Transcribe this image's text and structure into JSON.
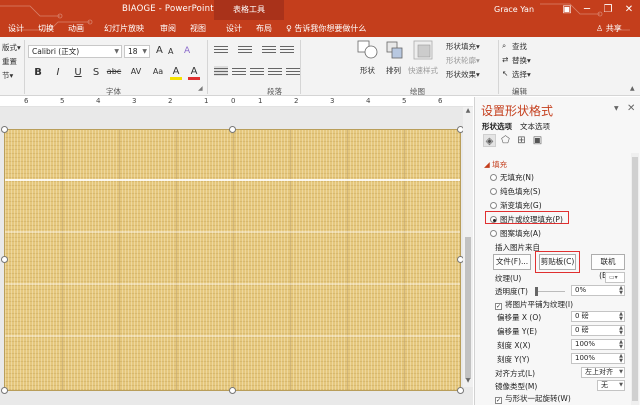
{
  "titlebar": {
    "doc_title": "BIAOGE  -  PowerPoint",
    "context_tab": "表格工具",
    "user": "Grace Yan",
    "controls": {
      "ribbon_display": "▣",
      "minimize": "─",
      "restore": "❐",
      "close": "✕"
    }
  },
  "tabs": [
    "设计",
    "切换",
    "动画",
    "幻灯片放映",
    "审阅",
    "视图",
    "设计",
    "布局"
  ],
  "tell_me": "♀ 告诉我你想要做什么",
  "share": "♙ 共享",
  "ribbon": {
    "left_partial": [
      "版式▾",
      "重置",
      "节▾"
    ],
    "font_name": "Calibri (正文)",
    "font_size": "18",
    "font_buttons": [
      "B",
      "I",
      "U",
      "S",
      "abc",
      "AV",
      "Aa",
      "A",
      "A"
    ],
    "font_group": "字体",
    "paragraph_group": "段落",
    "drawing_group": "绘图",
    "editing_group": "编辑",
    "shapes_label": "形状",
    "arrange_label": "排列",
    "quick_styles_label": "快速样式",
    "shape_fill": "形状填充▾",
    "shape_outline": "形状轮廓▾",
    "shape_effects": "形状效果▾",
    "find": "查找",
    "replace": "替换▾",
    "select": "选择▾",
    "font_size_up": "A",
    "font_size_down": "A",
    "clear_format": "A"
  },
  "ruler": {
    "numbers": [
      "6",
      "5",
      "4",
      "3",
      "2",
      "1",
      "0",
      "1",
      "2",
      "3",
      "4",
      "5",
      "6"
    ]
  },
  "pane": {
    "title": "设置形状格式",
    "tabs": [
      "形状选项",
      "文本选项"
    ],
    "section": "◢ 填充",
    "radios": [
      {
        "label": "无填充(N)",
        "on": false
      },
      {
        "label": "纯色填充(S)",
        "on": false
      },
      {
        "label": "渐变填充(G)",
        "on": false
      },
      {
        "label": "图片或纹理填充(P)",
        "on": true
      },
      {
        "label": "图案填充(A)",
        "on": false
      }
    ],
    "insert_from": "插入图片来自",
    "btn_file": "文件(F)...",
    "btn_clipboard": "剪贴板(C)",
    "btn_online": "联机(E)...",
    "texture_label": "纹理(U)",
    "transparency_label": "透明度(T)",
    "transparency_value": "0%",
    "tile_checkbox": "将图片平铺为纹理(I)",
    "offset_x_label": "偏移量 X (O)",
    "offset_x_value": "0 磅",
    "offset_y_label": "偏移量 Y(E)",
    "offset_y_value": "0 磅",
    "scale_x_label": "刻度 X(X)",
    "scale_x_value": "100%",
    "scale_y_label": "刻度 Y(Y)",
    "scale_y_value": "100%",
    "align_label": "对齐方式(L)",
    "align_value": "左上对齐",
    "mirror_label": "镜像类型(M)",
    "mirror_value": "无",
    "rotate_checkbox": "与形状一起旋转(W)"
  }
}
